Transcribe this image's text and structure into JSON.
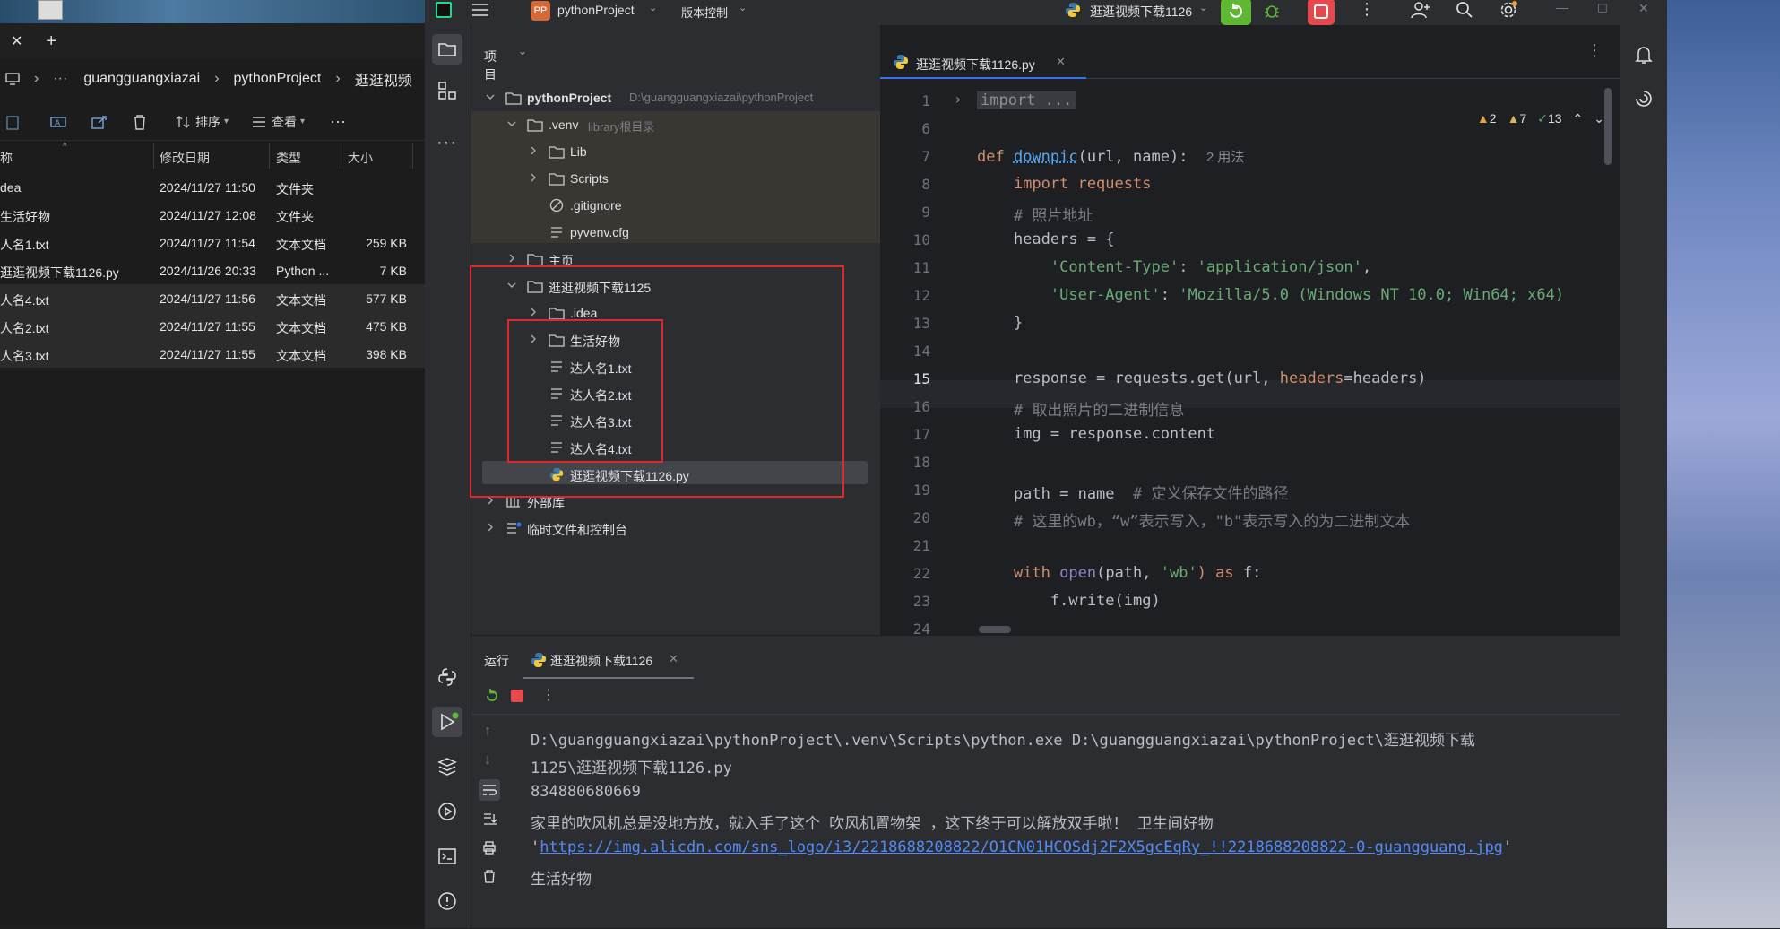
{
  "explorer": {
    "tab_close": "✕",
    "tab_add": "+",
    "breadcrumb": [
      "guangguangxiazai",
      "pythonProject",
      "逛逛视频"
    ],
    "toolbar": {
      "sort": "排序",
      "view": "查看",
      "more": "···"
    },
    "columns": {
      "name": "称",
      "modified": "修改日期",
      "type": "类型",
      "size": "大小"
    },
    "rows": [
      {
        "name": "dea",
        "modified": "2024/11/27 11:50",
        "type": "文件夹",
        "size": ""
      },
      {
        "name": "生活好物",
        "modified": "2024/11/27 12:08",
        "type": "文件夹",
        "size": ""
      },
      {
        "name": "人名1.txt",
        "modified": "2024/11/27 11:54",
        "type": "文本文档",
        "size": "259 KB"
      },
      {
        "name": "逛逛视频下载1126.py",
        "modified": "2024/11/26 20:33",
        "type": "Python ...",
        "size": "7 KB"
      },
      {
        "name": "人名4.txt",
        "modified": "2024/11/27 11:56",
        "type": "文本文档",
        "size": "577 KB"
      },
      {
        "name": "人名2.txt",
        "modified": "2024/11/27 11:55",
        "type": "文本文档",
        "size": "475 KB"
      },
      {
        "name": "人名3.txt",
        "modified": "2024/11/27 11:55",
        "type": "文本文档",
        "size": "398 KB"
      }
    ]
  },
  "ide": {
    "project_badge": "PP",
    "project_name": "pythonProject",
    "vcs": "版本控制",
    "run_config": "逛逛视频下载1126",
    "project_panel_title": "项目",
    "tree": {
      "root": "pythonProject",
      "root_path": "D:\\guangguangxiazai\\pythonProject",
      "venv": ".venv",
      "venv_hint": "library根目录",
      "lib": "Lib",
      "scripts": "Scripts",
      "gitignore": ".gitignore",
      "pyvenv": "pyvenv.cfg",
      "home": "主页",
      "folder1125": "逛逛视频下载1125",
      "idea": ".idea",
      "goods": "生活好物",
      "t1": "达人名1.txt",
      "t2": "达人名2.txt",
      "t3": "达人名3.txt",
      "t4": "达人名4.txt",
      "py": "逛逛视频下载1126.py",
      "ext": "外部库",
      "scratch": "临时文件和控制台"
    },
    "editor_tab": "逛逛视频下载1126.py",
    "inspections": {
      "warn": "2",
      "weak": "7",
      "ok": "13"
    },
    "line_numbers": [
      "1",
      "6",
      "7",
      "8",
      "9",
      "10",
      "11",
      "12",
      "13",
      "14",
      "15",
      "16",
      "17",
      "18",
      "19",
      "20",
      "21",
      "22",
      "23",
      "24"
    ],
    "code": {
      "l1": "import ...",
      "l7_def": "def ",
      "l7_fn": "downpic",
      "l7_rest": "(url, name):",
      "l7_hint": "2 用法",
      "l8": "    import requests",
      "l9": "    # 照片地址",
      "l10": "    headers = {",
      "l11_key": "'Content-Type'",
      "l11_val": "'application/json'",
      "l12_key": "'User-Agent'",
      "l12_val": "'Mozilla/5.0 (Windows NT 10.0; Win64; x64)",
      "l13": "    }",
      "l15_a": "    response = requests.get(url, ",
      "l15_p": "headers",
      "l15_b": "=headers)",
      "l16": "    # 取出照片的二进制信息",
      "l17": "    img = response.content",
      "l19_a": "    path = name  ",
      "l19_c": "# 定义保存文件的路径",
      "l20": "    # 这里的wb，“w”表示写入，\"b\"表示写入的为二进制文本",
      "l22_with": "with ",
      "l22_open": "open",
      "l22_mid": "(path, ",
      "l22_str": "'wb'",
      "l22_as": ") as ",
      "l22_f": "f:",
      "l23": "        f.write(img)"
    },
    "run": {
      "label": "运行",
      "tab": "逛逛视频下载1126",
      "out1": "D:\\guangguangxiazai\\pythonProject\\.venv\\Scripts\\python.exe D:\\guangguangxiazai\\pythonProject\\逛逛视频下载",
      "out2": " 1125\\逛逛视频下载1126.py",
      "out3": "834880680669",
      "out4": "家里的吹风机总是没地方放，就入手了这个 吹风机置物架 ，这下终于可以解放双手啦！ 卫生间好物",
      "out5_q": "'",
      "out5_url": "https://img.alicdn.com/sns_logo/i3/2218688208822/O1CN01HCOSdj2F2X5gcEqRy_!!2218688208822-0-guangguang.jpg",
      "out6": "生活好物"
    },
    "colors": {
      "accent": "#3574f0",
      "highlight_box": "#e0282c",
      "run_green": "#5fb832",
      "stop_red": "#e5484d"
    }
  }
}
